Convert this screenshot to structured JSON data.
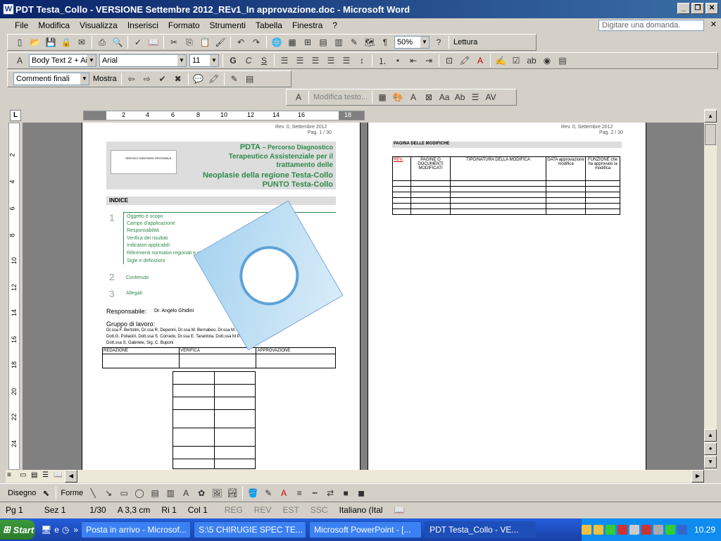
{
  "window": {
    "title": "PDT Testa_Collo -  VERSIONE Settembre 2012_REv1_In approvazione.doc - Microsoft Word",
    "icon": "W",
    "help_placeholder": "Digitare una domanda."
  },
  "menu": [
    "File",
    "Modifica",
    "Visualizza",
    "Inserisci",
    "Formato",
    "Strumenti",
    "Tabella",
    "Finestra",
    "?"
  ],
  "toolbar_std": {
    "zoom": "50%",
    "reading": "Lettura"
  },
  "toolbar_fmt": {
    "style": "Body Text 2 + Ai",
    "font": "Arial",
    "size": "11"
  },
  "toolbar_review": {
    "display": "Commenti finali",
    "show": "Mostra"
  },
  "toolbar_extra": {
    "edit": "Modifica testo..."
  },
  "page1": {
    "rev": "Rev. 0, Settembre 2012",
    "pag": "Pag. 1 / 30",
    "header_org": "SERVIZIO SANITARIO REGIONALE",
    "title1": "PDTA",
    "title1b": " – Percorso Diagnostico",
    "title2": "Terapeutico Assistenziale per il",
    "title3": "trattamento delle",
    "title4": "Neoplasie della regione Testa-Collo",
    "title5": "PUNTO Testa-Collo",
    "indice": "INDICE",
    "num1": "1",
    "num2": "2",
    "num3": "3",
    "items": [
      "Oggetto e scopo",
      "Campo d'applicazione",
      "Responsabilità",
      "Verifica dei risultati",
      "Indicatori applicabili",
      "Riferimenti normativi regionali e nazionali",
      "Sigle e definizioni"
    ],
    "contenuto": "Contenuto",
    "allegati": "Allegati",
    "responsabile_label": "Responsabile:",
    "responsabile": "Dr. Angelo Ghidini",
    "gruppo": "Gruppo di lavoro:",
    "gruppo_lines": [
      "Dr.ssa F. Bertolini, Dr.ssa R. Depenni, Dr.ssa M. Bernabeo, Dr.ssa M. Cittadini,",
      "Dott.G. Pollastri, Dott.ssa S. Corrado, Dr.ssa E. Tarantola, Dott.ssa M.P. Lugli, Dott. ...d,",
      "Dott.ssa S. Gabriele, Sig. C. Buponi"
    ],
    "table_heads": [
      "REDAZIONE",
      "VERIFICA",
      "APPROVAZIONE"
    ]
  },
  "page2": {
    "rev": "Rev. 0, Settembre 2012",
    "pag": "Pag. 2 / 30",
    "heading": "PAGINA DELLE MODIFICHE",
    "cols": [
      "REV.",
      "PAGINE O DOCUMENTI MODIFICATI",
      "TIPO/NATURA DELLA MODIFICA",
      "DATA approvazione modifica",
      "FUNZIONE che ha approvato la modifica"
    ]
  },
  "drawbar": {
    "draw": "Disegno",
    "shapes": "Forme"
  },
  "status": {
    "pg": "Pg  1",
    "sez": "Sez  1",
    "pages": "1/30",
    "pos": "A  3,3 cm",
    "ri": "Ri  1",
    "col": "Col  1",
    "reg": "REG",
    "rev": "REV",
    "est": "EST",
    "ssc": "SSC",
    "lang": "Italiano (Ital"
  },
  "taskbar": {
    "start": "Start",
    "tasks": [
      "Posta in arrivo - Microsof...",
      "S:\\5 CHIRUGIE SPEC TE...",
      "Microsoft PowerPoint - [...",
      "PDT Testa_Collo - VE..."
    ],
    "clock": "10.29"
  }
}
